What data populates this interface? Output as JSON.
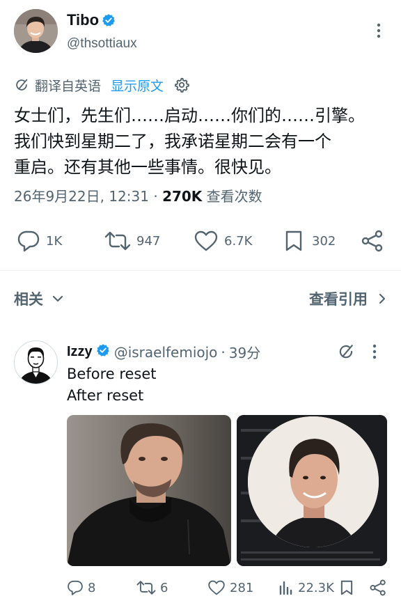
{
  "tweet": {
    "author_name": "Tibo",
    "author_handle": "@thsottiaux",
    "translated_from": "翻译自英语",
    "show_original": "显示原文",
    "text_lines": [
      "女士们，先生们……启动……你们的……引擎。",
      "我们快到星期二了，我承诺星期二会有一个",
      "重启。还有其他一些事情。很快见。"
    ],
    "timestamp": "26年9月22日, 12:31",
    "views_count": "270K",
    "views_label": "查看次数",
    "actions": {
      "replies": "1K",
      "retweets": "947",
      "likes": "6.7K",
      "bookmarks": "302"
    }
  },
  "section": {
    "related_label": "相关",
    "view_quotes_label": "查看引用"
  },
  "reply": {
    "author_name": "Izzy",
    "author_handle": "@israelfemiojo",
    "separator": "·",
    "time_ago": "39分",
    "text_lines": [
      "Before reset",
      "After reset"
    ],
    "actions": {
      "replies": "8",
      "retweets": "6",
      "likes": "281",
      "views": "22.3K"
    }
  },
  "colors": {
    "text_primary": "#0f1419",
    "text_secondary": "#536471",
    "accent": "#1d9bf0",
    "divider": "#eff3f4"
  },
  "icons": {
    "verified": "verified-badge-icon",
    "translate": "translate-icon",
    "settings": "gear-icon",
    "more": "more-vertical-icon",
    "reply": "reply-bubble-icon",
    "retweet": "retweet-icon",
    "like": "heart-icon",
    "bookmark": "bookmark-icon",
    "share": "share-icon",
    "views": "bar-chart-icon",
    "chevron_down": "chevron-down-icon",
    "chevron_right": "chevron-right-icon"
  }
}
